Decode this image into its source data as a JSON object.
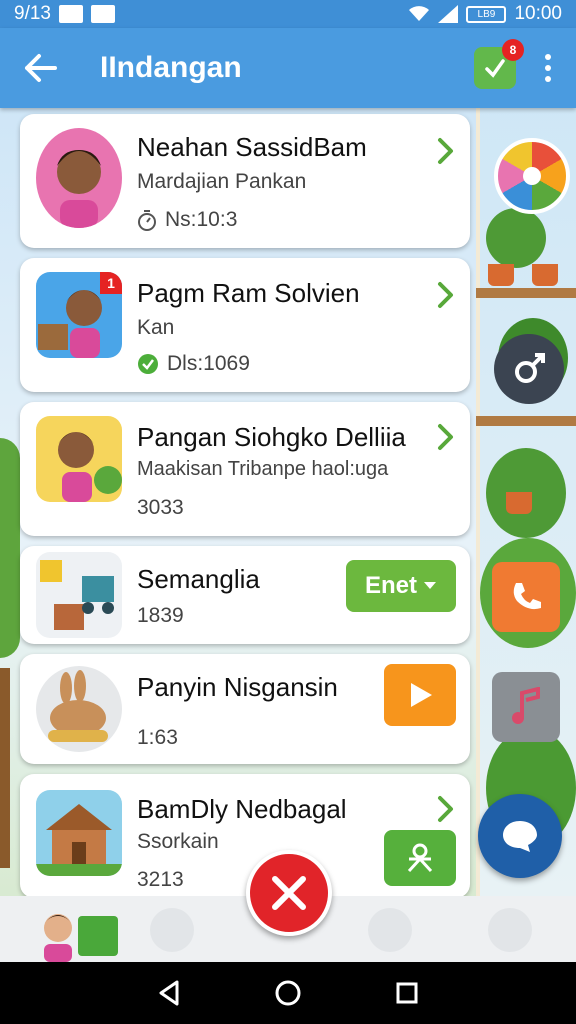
{
  "status": {
    "date": "9/13",
    "clock": "10:00",
    "battery": "LB9"
  },
  "header": {
    "title": "IIndangan",
    "task_badge": "8"
  },
  "items": [
    {
      "title": "Neahan SassidBam",
      "subtitle": "Mardajian Pankan",
      "meta": "Ns:10:3",
      "meta_icon": "stopwatch-icon",
      "action": "chevron"
    },
    {
      "title": "Pagm Ram Solvien",
      "subtitle": "Kan",
      "meta": "Dls:1069",
      "meta_icon": "check-circle-icon",
      "thumb_badge": "1",
      "action": "chevron"
    },
    {
      "title": "Pangan Siohgko Delliia",
      "subtitle": "Maakisan Tribanpe haol:uga",
      "meta": "3033",
      "action": "chevron"
    },
    {
      "title": "Semanglia",
      "meta": "1839",
      "action": "enter",
      "action_label": "Enet"
    },
    {
      "title": "Panyin Nisgansin",
      "meta": "1:63",
      "action": "play"
    },
    {
      "title": "BamDly Nedbagal",
      "subtitle": "Ssorkain",
      "meta": "3213",
      "action": "chevron-person"
    }
  ],
  "colors": {
    "app_bar": "#4a9be0",
    "enter_green": "#6cb83e",
    "play_orange": "#f7951c",
    "close_red": "#e12429",
    "chat_blue": "#1f5fa8"
  }
}
